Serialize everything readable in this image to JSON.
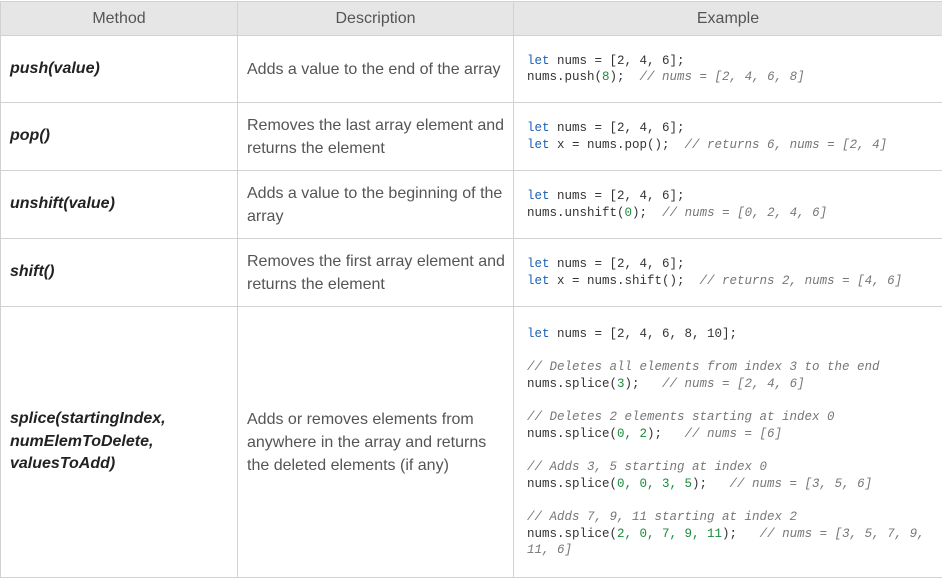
{
  "headers": [
    "Method",
    "Description",
    "Example"
  ],
  "rows": [
    {
      "method": "push(value)",
      "description": "Adds a value to the end of the array",
      "code": [
        [
          {
            "t": "let",
            "c": "kw"
          },
          {
            "t": " nums = [2, 4, 6];"
          }
        ],
        [
          {
            "t": "nums.push("
          },
          {
            "t": "8",
            "c": "num"
          },
          {
            "t": ");  "
          },
          {
            "t": "// nums = [2, 4, 6, 8]",
            "c": "cm"
          }
        ]
      ]
    },
    {
      "method": "pop()",
      "description": "Removes the last array element and returns the element",
      "code": [
        [
          {
            "t": "let",
            "c": "kw"
          },
          {
            "t": " nums = [2, 4, 6];"
          }
        ],
        [
          {
            "t": "let",
            "c": "kw"
          },
          {
            "t": " x = nums.pop();  "
          },
          {
            "t": "// returns 6, nums = [2, 4]",
            "c": "cm"
          }
        ]
      ]
    },
    {
      "method": "unshift(value)",
      "description": "Adds a value to the beginning of the array",
      "code": [
        [
          {
            "t": "let",
            "c": "kw"
          },
          {
            "t": " nums = [2, 4, 6];"
          }
        ],
        [
          {
            "t": "nums.unshift("
          },
          {
            "t": "0",
            "c": "num"
          },
          {
            "t": ");  "
          },
          {
            "t": "// nums = [0, 2, 4, 6]",
            "c": "cm"
          }
        ]
      ]
    },
    {
      "method": "shift()",
      "description": "Removes the first array element and returns the element",
      "code": [
        [
          {
            "t": "let",
            "c": "kw"
          },
          {
            "t": " nums = [2, 4, 6];"
          }
        ],
        [
          {
            "t": "let",
            "c": "kw"
          },
          {
            "t": " x = nums.shift();  "
          },
          {
            "t": "// returns 2, nums = [4, 6]",
            "c": "cm"
          }
        ]
      ]
    },
    {
      "method": "splice(startingIndex, numElemToDelete, valuesToAdd)",
      "description": "Adds or removes elements from anywhere in the array and returns the deleted elements (if any)",
      "code": [
        [
          {
            "t": "let",
            "c": "kw"
          },
          {
            "t": " nums = [2, 4, 6, 8, 10];"
          }
        ],
        [],
        [
          {
            "t": "// Deletes all elements from index 3 to the end",
            "c": "cm"
          }
        ],
        [
          {
            "t": "nums.splice("
          },
          {
            "t": "3",
            "c": "num"
          },
          {
            "t": ");   "
          },
          {
            "t": "// nums = [2, 4, 6]",
            "c": "cm"
          }
        ],
        [],
        [
          {
            "t": "// Deletes 2 elements starting at index 0",
            "c": "cm"
          }
        ],
        [
          {
            "t": "nums.splice("
          },
          {
            "t": "0, 2",
            "c": "num"
          },
          {
            "t": ");   "
          },
          {
            "t": "// nums = [6]",
            "c": "cm"
          }
        ],
        [],
        [
          {
            "t": "// Adds 3, 5 starting at index 0",
            "c": "cm"
          }
        ],
        [
          {
            "t": "nums.splice("
          },
          {
            "t": "0, 0, 3, 5",
            "c": "num"
          },
          {
            "t": ");   "
          },
          {
            "t": "// nums = [3, 5, 6]",
            "c": "cm"
          }
        ],
        [],
        [
          {
            "t": "// Adds 7, 9, 11 starting at index 2",
            "c": "cm"
          }
        ],
        [
          {
            "t": "nums.splice("
          },
          {
            "t": "2, 0, 7, 9, 11",
            "c": "num"
          },
          {
            "t": ");   "
          },
          {
            "t": "// nums = [3, 5, 7, 9, 11, 6]",
            "c": "cm"
          }
        ]
      ]
    }
  ]
}
